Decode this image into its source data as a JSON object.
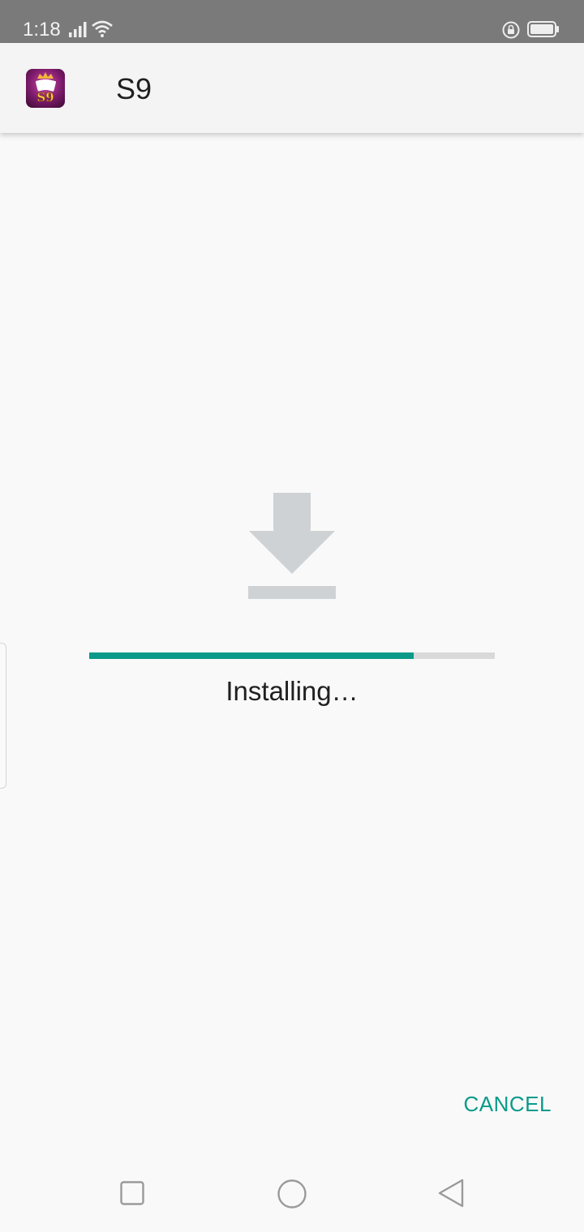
{
  "status_bar": {
    "time": "1:18",
    "icons": [
      "signal-icon",
      "wifi-icon",
      "rotation-lock-icon",
      "battery-icon"
    ]
  },
  "header": {
    "app_icon": "s9-app-icon",
    "title": "S9"
  },
  "install": {
    "icon": "download-icon",
    "progress": 0.8,
    "status": "Installing…"
  },
  "actions": {
    "cancel_label": "CANCEL"
  },
  "nav_bar": {
    "icons": [
      "recent-apps-icon",
      "home-icon",
      "back-icon"
    ]
  },
  "colors": {
    "accent": "#0a9a8a",
    "track": "#d9d9d9",
    "icon_gray": "#cfd2d5",
    "status_bar": "#7a7a7a",
    "background": "#f9f9f9"
  }
}
